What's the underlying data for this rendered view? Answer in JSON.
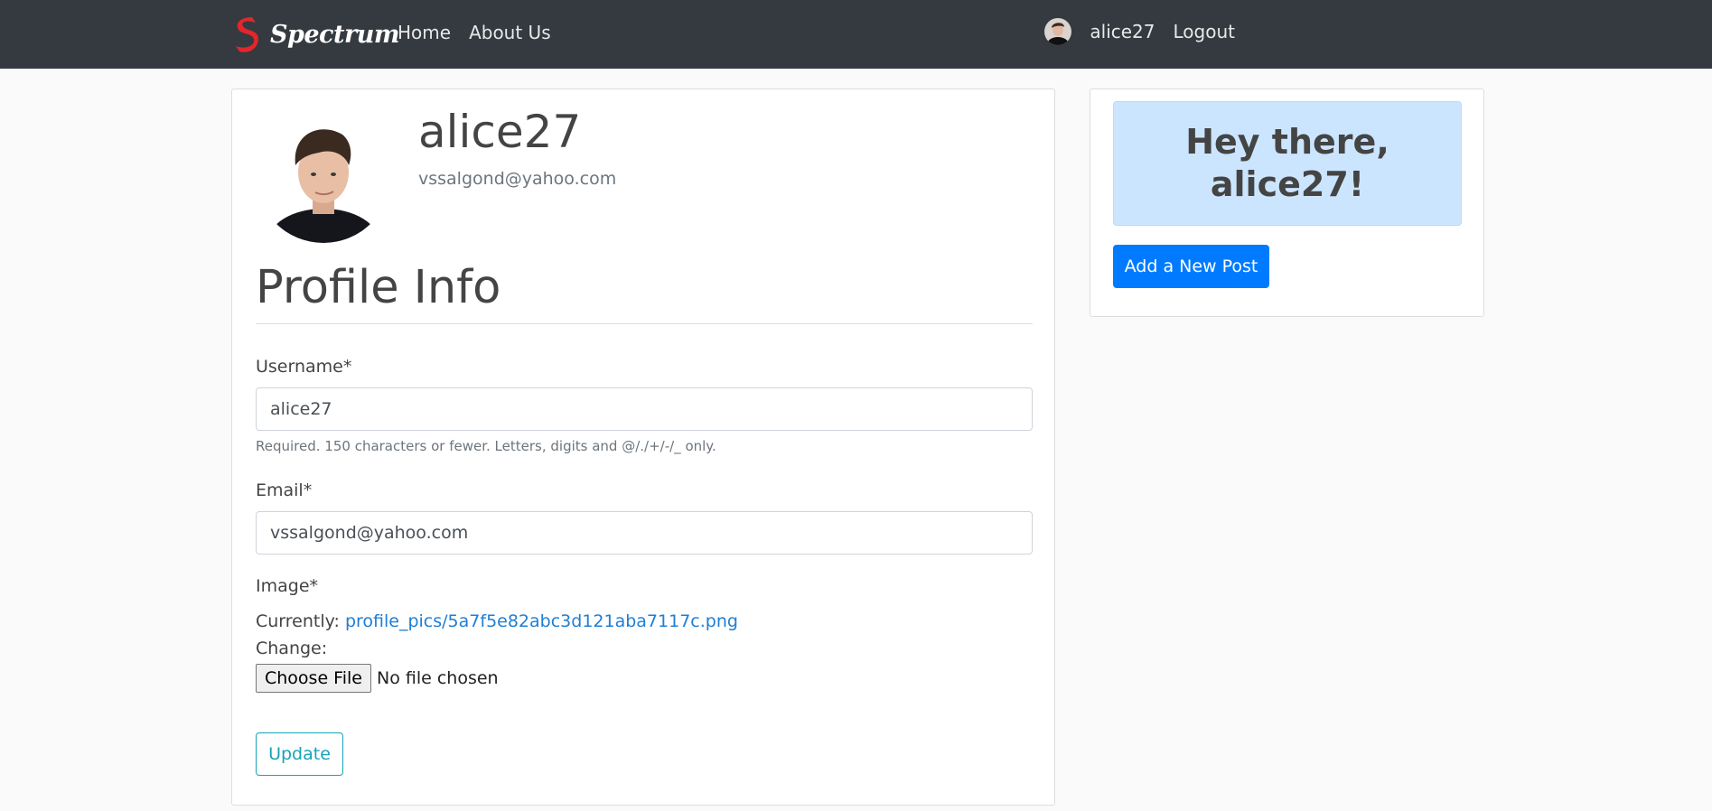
{
  "navbar": {
    "brand": "Spectrum",
    "links": [
      {
        "label": "Home"
      },
      {
        "label": "About Us"
      }
    ],
    "username": "alice27",
    "logout_label": "Logout"
  },
  "profile": {
    "username": "alice27",
    "email": "vssalgond@yahoo.com"
  },
  "form": {
    "title": "Profile Info",
    "username_label": "Username*",
    "username_value": "alice27",
    "username_help": "Required. 150 characters or fewer. Letters, digits and @/./+/-/_ only.",
    "email_label": "Email*",
    "email_value": "vssalgond@yahoo.com",
    "image_label": "Image*",
    "currently_label": "Currently:",
    "current_image": "profile_pics/5a7f5e82abc3d121aba7117c.png",
    "change_label": "Change:",
    "choose_file_label": "Choose File",
    "file_status": "No file chosen",
    "update_label": "Update"
  },
  "sidebar": {
    "greeting": "Hey there, alice27!",
    "new_post_label": "Add a New Post"
  },
  "colors": {
    "navbar": "#343a40",
    "primary": "#007bff",
    "info": "#17a2b8",
    "alert_bg": "#cce5ff",
    "brand_logo": "#e3262b"
  }
}
